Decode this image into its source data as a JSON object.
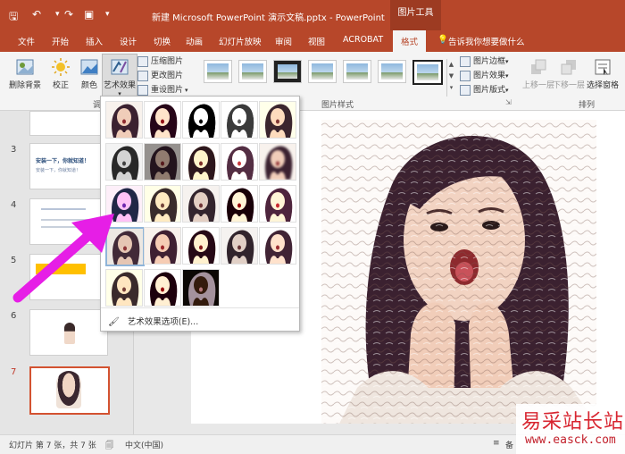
{
  "title_bar": {
    "save_icon": "save-icon",
    "undo_icon": "undo-icon",
    "redo_icon": "redo-icon",
    "present_icon": "present-icon",
    "doc_title": "新建 Microsoft PowerPoint 演示文稿.pptx - PowerPoint",
    "context_title": "图片工具"
  },
  "tabs": [
    "文件",
    "开始",
    "插入",
    "设计",
    "切换",
    "动画",
    "幻灯片放映",
    "审阅",
    "视图",
    "ACROBAT",
    "格式"
  ],
  "active_tab": "格式",
  "tell_me": "告诉我你想要做什么",
  "ribbon": {
    "remove_bg": "删除背景",
    "corrections": "校正",
    "color": "颜色",
    "artistic_effects": "艺术效果",
    "compress": "压缩图片",
    "change": "更改图片",
    "reset": "重设图片",
    "adjust_group": "调",
    "styles_group": "图片样式",
    "border": "图片边框",
    "effects": "图片效果",
    "layout": "图片版式",
    "bring_forward": "上移一层",
    "send_backward": "下移一层",
    "selection_pane": "选择窗格",
    "arrange_group": "排列"
  },
  "slides": [
    {
      "num": "3",
      "text": "",
      "selected": false
    },
    {
      "num": "4",
      "text": "",
      "selected": false
    },
    {
      "num": "5",
      "text": "",
      "selected": false
    },
    {
      "num": "6",
      "text": "",
      "selected": false
    },
    {
      "num": "7",
      "text": "",
      "selected": true
    }
  ],
  "thumb3_text": "安装一下，你就知道！",
  "thumb3_text2": "安装一下，你就知道！",
  "gallery": {
    "options_label": "艺术效果选项(E)...",
    "options_icon": "art-effects-options-icon",
    "rows": 5,
    "cols": 5,
    "cell_count": 23,
    "selected_index": 15
  },
  "status": {
    "slide_info": "幻灯片 第 7 张，共 7 张",
    "language": "中文(中国)",
    "notes": "备"
  },
  "watermark": {
    "cn": "易采站长站",
    "url": "www.easck.com"
  },
  "colors": {
    "accent": "#b7472a",
    "arrow": "#e61ee6",
    "selection": "#d35230"
  }
}
